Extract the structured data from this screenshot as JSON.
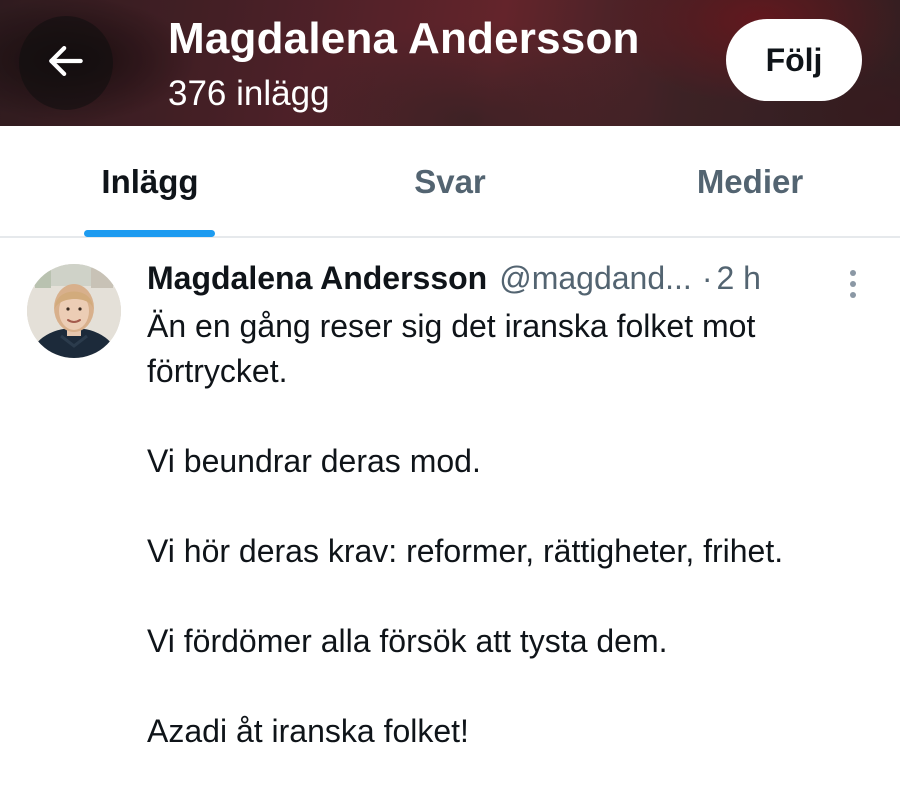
{
  "header": {
    "name": "Magdalena Andersson",
    "post_count": "376 inlägg",
    "follow_label": "Följ",
    "back_icon": "arrow-left-icon"
  },
  "tabs": [
    {
      "label": "Inlägg",
      "active": true
    },
    {
      "label": "Svar",
      "active": false
    },
    {
      "label": "Medier",
      "active": false
    }
  ],
  "post": {
    "author": "Magdalena Andersson",
    "handle": "@magdand...",
    "separator": "·",
    "time": "2 h",
    "more_icon": "more-vertical-icon",
    "paragraphs": [
      "Än en gång reser sig det iranska folket mot förtrycket.",
      "Vi beundrar deras mod.",
      "Vi hör deras krav: reformer, rättigheter, frihet.",
      "Vi fördömer alla försök att tysta dem.",
      "Azadi åt iranska folket!"
    ]
  },
  "colors": {
    "accent": "#1d9bf0",
    "text_primary": "#0f1419",
    "text_secondary": "#536471",
    "divider": "#e6e9ec"
  }
}
